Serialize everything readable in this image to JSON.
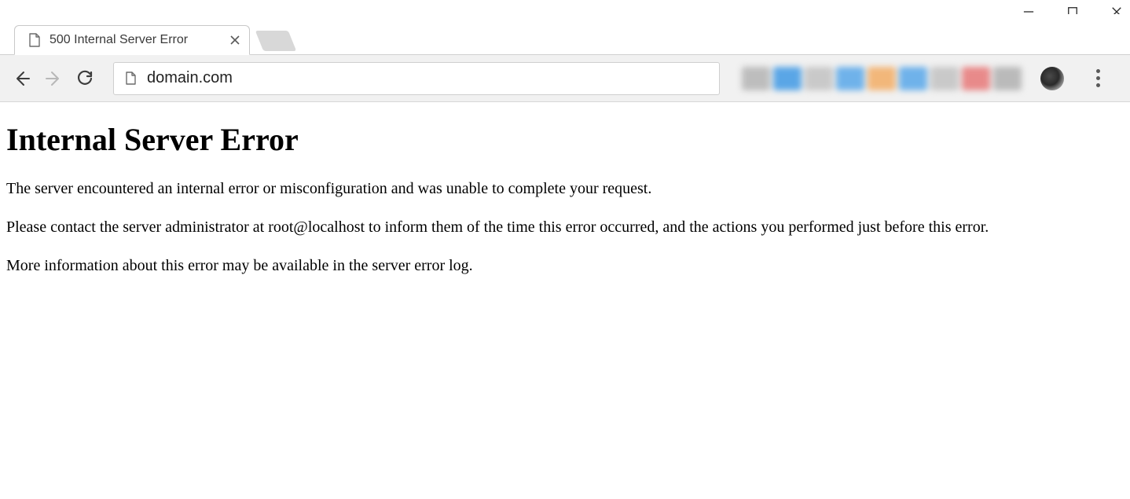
{
  "window": {
    "controls": {
      "minimize": "minimize",
      "maximize": "maximize",
      "close": "close"
    }
  },
  "tabs": {
    "active": {
      "title": "500 Internal Server Error"
    }
  },
  "toolbar": {
    "address_url": "domain.com"
  },
  "extensions": {
    "swatches": [
      "#bdbdbd",
      "#5aa6e6",
      "#c9c9c9",
      "#6fb2ea",
      "#f2b77a",
      "#6fb2ea",
      "#c9c9c9",
      "#e88a8a",
      "#bababa"
    ]
  },
  "page": {
    "heading": "Internal Server Error",
    "paragraph1": "The server encountered an internal error or misconfiguration and was unable to complete your request.",
    "paragraph2": "Please contact the server administrator at root@localhost to inform them of the time this error occurred, and the actions you performed just before this error.",
    "paragraph3": "More information about this error may be available in the server error log."
  }
}
